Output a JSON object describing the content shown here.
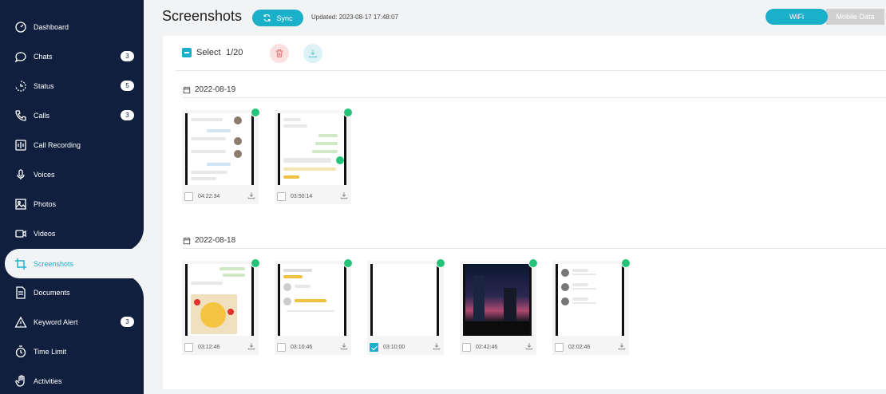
{
  "sidebar": {
    "items": [
      {
        "label": "Dashboard",
        "icon": "dashboard-icon",
        "badge": ""
      },
      {
        "label": "Chats",
        "icon": "chat-icon",
        "badge": "3"
      },
      {
        "label": "Status",
        "icon": "status-icon",
        "badge": "5"
      },
      {
        "label": "Calls",
        "icon": "phone-icon",
        "badge": "3"
      },
      {
        "label": "Call Recording",
        "icon": "call-recording-icon",
        "badge": ""
      },
      {
        "label": "Voices",
        "icon": "microphone-icon",
        "badge": ""
      },
      {
        "label": "Photos",
        "icon": "photo-icon",
        "badge": ""
      },
      {
        "label": "Videos",
        "icon": "video-icon",
        "badge": ""
      },
      {
        "label": "Screenshots",
        "icon": "crop-icon",
        "badge": ""
      },
      {
        "label": "Documents",
        "icon": "document-icon",
        "badge": ""
      },
      {
        "label": "Keyword Alert",
        "icon": "alert-icon",
        "badge": "3"
      },
      {
        "label": "Time Limit",
        "icon": "timer-icon",
        "badge": ""
      },
      {
        "label": "Activities",
        "icon": "hand-icon",
        "badge": ""
      }
    ]
  },
  "header": {
    "title": "Screenshots",
    "sync_label": "Sync",
    "updated": "Updated: 2023-08-17 17:48:07",
    "wifi_label": "WiFi",
    "mobile_label": "Mobile Data"
  },
  "toolbar": {
    "select_label": "Select",
    "count": "1/20"
  },
  "groups": [
    {
      "date": "2022-08-19",
      "items": [
        {
          "time": "04:22:34",
          "checked": false
        },
        {
          "time": "03:50:14",
          "checked": false
        }
      ]
    },
    {
      "date": "2022-08-18",
      "items": [
        {
          "time": "03:12:46",
          "checked": false
        },
        {
          "time": "03:10:46",
          "checked": false
        },
        {
          "time": "03:10:00",
          "checked": true
        },
        {
          "time": "02:42:46",
          "checked": false
        },
        {
          "time": "02:02:46",
          "checked": false
        }
      ]
    }
  ],
  "colors": {
    "sidebar_bg": "#0f1f3d",
    "accent": "#1ab0c9",
    "whatsapp_green": "#25c47a"
  }
}
